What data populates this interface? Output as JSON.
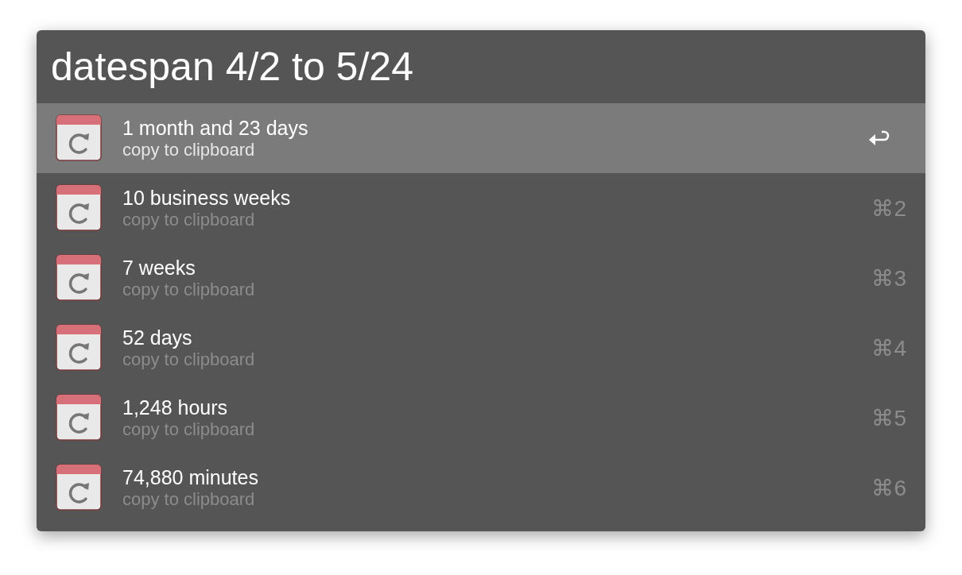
{
  "search": {
    "value": "datespan 4/2 to 5/24"
  },
  "results": [
    {
      "title": "1 month and 23 days",
      "subtitle": "copy to clipboard",
      "selected": true
    },
    {
      "title": "10 business weeks",
      "subtitle": "copy to clipboard",
      "shortcut": "⌘2",
      "selected": false
    },
    {
      "title": "7 weeks",
      "subtitle": "copy to clipboard",
      "shortcut": "⌘3",
      "selected": false
    },
    {
      "title": "52 days",
      "subtitle": "copy to clipboard",
      "shortcut": "⌘4",
      "selected": false
    },
    {
      "title": "1,248 hours",
      "subtitle": "copy to clipboard",
      "shortcut": "⌘5",
      "selected": false
    },
    {
      "title": "74,880 minutes",
      "subtitle": "copy to clipboard",
      "shortcut": "⌘6",
      "selected": false
    }
  ]
}
